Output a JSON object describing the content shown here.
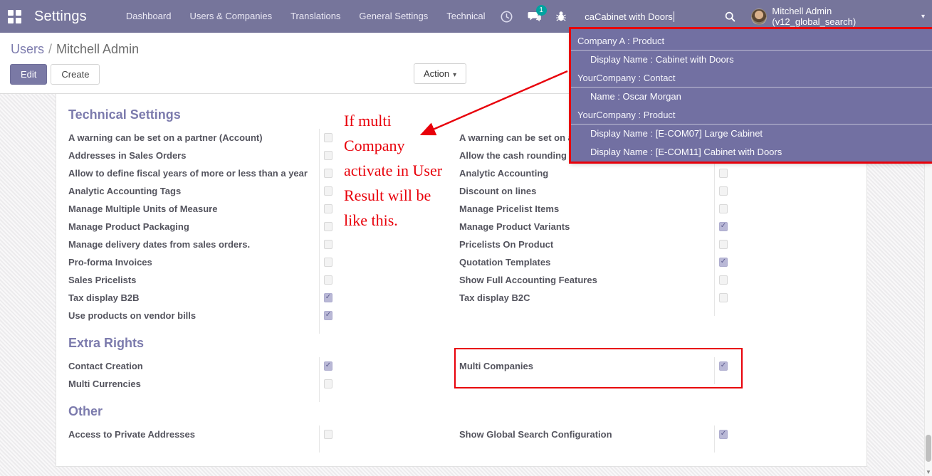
{
  "navbar": {
    "app_title": "Settings",
    "menu_items": [
      "Dashboard",
      "Users & Companies",
      "Translations",
      "General Settings",
      "Technical"
    ],
    "badge_count": "1",
    "search_value": "caCabinet with Doors",
    "user_name": "Mitchell Admin (v12_global_search)"
  },
  "breadcrumb": {
    "link": "Users",
    "separator": "/",
    "current": "Mitchell Admin"
  },
  "actions": {
    "edit": "Edit",
    "create": "Create",
    "action": "Action"
  },
  "search_dropdown": {
    "groups": [
      {
        "header": "Company A : Product",
        "items": [
          "Display Name : Cabinet with Doors"
        ]
      },
      {
        "header": "YourCompany : Contact",
        "items": [
          "Name : Oscar Morgan"
        ]
      },
      {
        "header": "YourCompany : Product",
        "items": [
          "Display Name : [E-COM07] Large Cabinet",
          "Display Name : [E-COM11] Cabinet with Doors"
        ]
      }
    ]
  },
  "annotation": {
    "lines": [
      "If multi",
      "Company",
      "activate in User",
      "Result will be",
      "like this."
    ]
  },
  "sections": [
    {
      "title": "Technical Settings",
      "left": [
        {
          "label": "A warning can be set on a partner (Account)",
          "checked": false
        },
        {
          "label": "Addresses in Sales Orders",
          "checked": false
        },
        {
          "label": "Allow to define fiscal years of more or less than a year",
          "checked": false
        },
        {
          "label": "Analytic Accounting Tags",
          "checked": false
        },
        {
          "label": "Manage Multiple Units of Measure",
          "checked": false
        },
        {
          "label": "Manage Product Packaging",
          "checked": false
        },
        {
          "label": "Manage delivery dates from sales orders.",
          "checked": false
        },
        {
          "label": "Pro-forma Invoices",
          "checked": false
        },
        {
          "label": "Sales Pricelists",
          "checked": false
        },
        {
          "label": "Tax display B2B",
          "checked": true
        },
        {
          "label": "Use products on vendor bills",
          "checked": true
        }
      ],
      "right": [
        {
          "label": "A warning can be set on a",
          "checked": false
        },
        {
          "label": "Allow the cash rounding m",
          "checked": false
        },
        {
          "label": "Analytic Accounting",
          "checked": false
        },
        {
          "label": "Discount on lines",
          "checked": false
        },
        {
          "label": "Manage Pricelist Items",
          "checked": false
        },
        {
          "label": "Manage Product Variants",
          "checked": true
        },
        {
          "label": "Pricelists On Product",
          "checked": false
        },
        {
          "label": "Quotation Templates",
          "checked": true
        },
        {
          "label": "Show Full Accounting Features",
          "checked": false
        },
        {
          "label": "Tax display B2C",
          "checked": false
        }
      ]
    },
    {
      "title": "Extra Rights",
      "left": [
        {
          "label": "Contact Creation",
          "checked": true
        },
        {
          "label": "Multi Currencies",
          "checked": false
        }
      ],
      "right": [
        {
          "label": "Multi Companies",
          "checked": true,
          "highlighted": true
        }
      ]
    },
    {
      "title": "Other",
      "left": [
        {
          "label": "Access to Private Addresses",
          "checked": false
        }
      ],
      "right": [
        {
          "label": "Show Global Search Configuration",
          "checked": true
        }
      ]
    }
  ],
  "glyphs": {
    "caret": "▾",
    "check": "✓",
    "scroll_down_arrow": "▼"
  },
  "colors": {
    "navbar_bg": "#76759b",
    "dropdown_bg": "#7270a2",
    "accent_purple": "#7c7bad",
    "annotation_red": "#e8000a",
    "badge_teal": "#00a3a0",
    "checkbox_checked": "#b9b8d6"
  }
}
